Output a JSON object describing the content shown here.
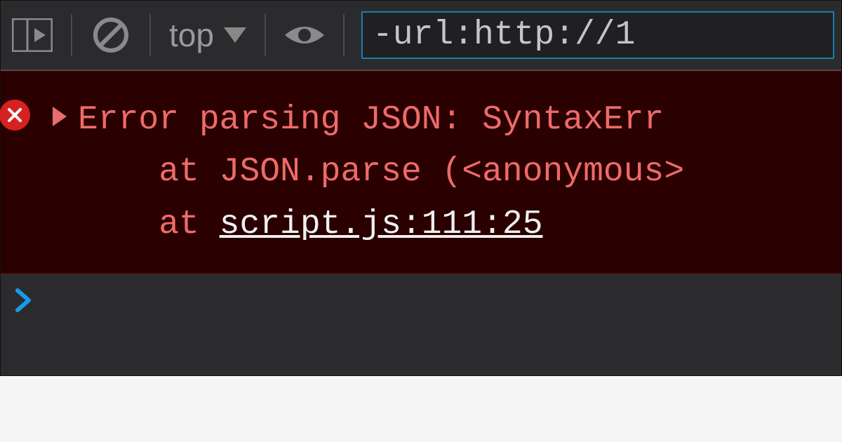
{
  "toolbar": {
    "scope_label": "top",
    "filter_value": "-url:http://1"
  },
  "error": {
    "line1": "Error parsing JSON: SyntaxErr",
    "line2_prefix": "    at JSON.parse (<anonymous>",
    "line3_prefix": "    at ",
    "source_link": "script.js:111:25"
  }
}
